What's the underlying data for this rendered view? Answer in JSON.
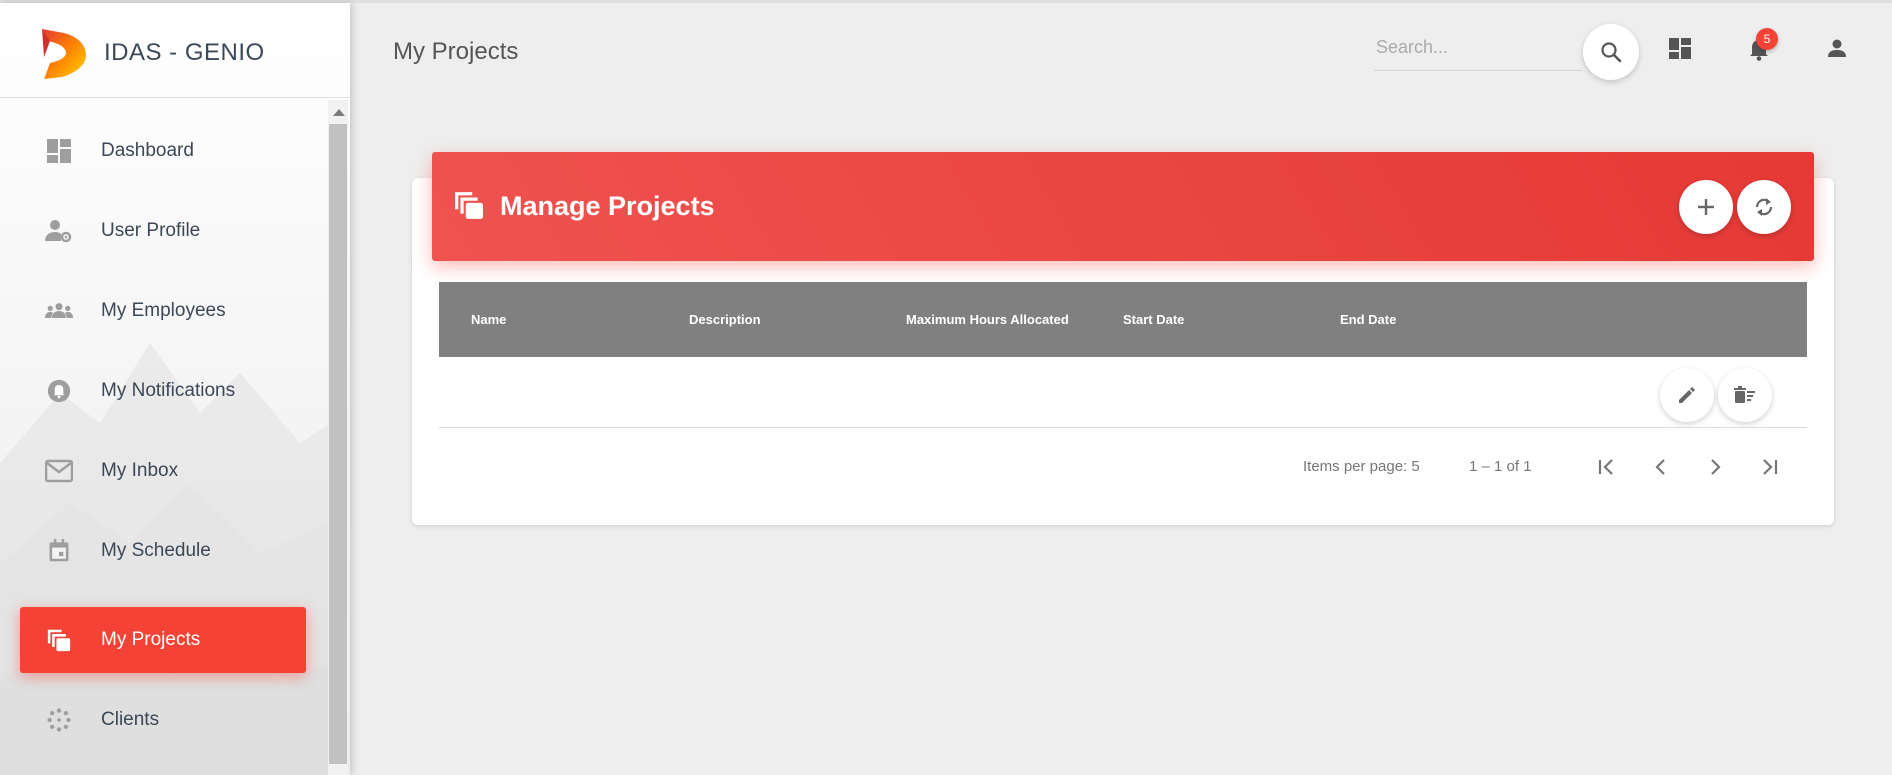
{
  "app": {
    "title": "IDAS - GENIO"
  },
  "sidebar": {
    "items": [
      {
        "label": "Dashboard",
        "icon": "dashboard-icon",
        "active": false
      },
      {
        "label": "User Profile",
        "icon": "user-settings-icon",
        "active": false
      },
      {
        "label": "My Employees",
        "icon": "group-icon",
        "active": false
      },
      {
        "label": "My Notifications",
        "icon": "notification-icon",
        "active": false
      },
      {
        "label": "My Inbox",
        "icon": "mail-icon",
        "active": false
      },
      {
        "label": "My Schedule",
        "icon": "calendar-icon",
        "active": false
      },
      {
        "label": "My Projects",
        "icon": "projects-icon",
        "active": true
      },
      {
        "label": "Clients",
        "icon": "clients-icon",
        "active": false
      }
    ]
  },
  "header": {
    "page_title": "My Projects",
    "search_placeholder": "Search...",
    "notification_count": "5"
  },
  "card": {
    "title": "Manage Projects",
    "columns": [
      "Name",
      "Description",
      "Maximum Hours Allocated",
      "Start Date",
      "End Date"
    ],
    "rows": [
      {
        "Name": "",
        "Description": "",
        "Maximum Hours Allocated": "",
        "Start Date": "",
        "End Date": ""
      }
    ]
  },
  "paginator": {
    "items_per_page_label": "Items per page:",
    "items_per_page_value": "5",
    "range_label": "1 – 1 of 1"
  },
  "colors": {
    "accent": "#f44336",
    "header_gradient_start": "#ef5350",
    "header_gradient_end": "#e53935",
    "table_header": "#808080",
    "background": "#eeeeee"
  }
}
